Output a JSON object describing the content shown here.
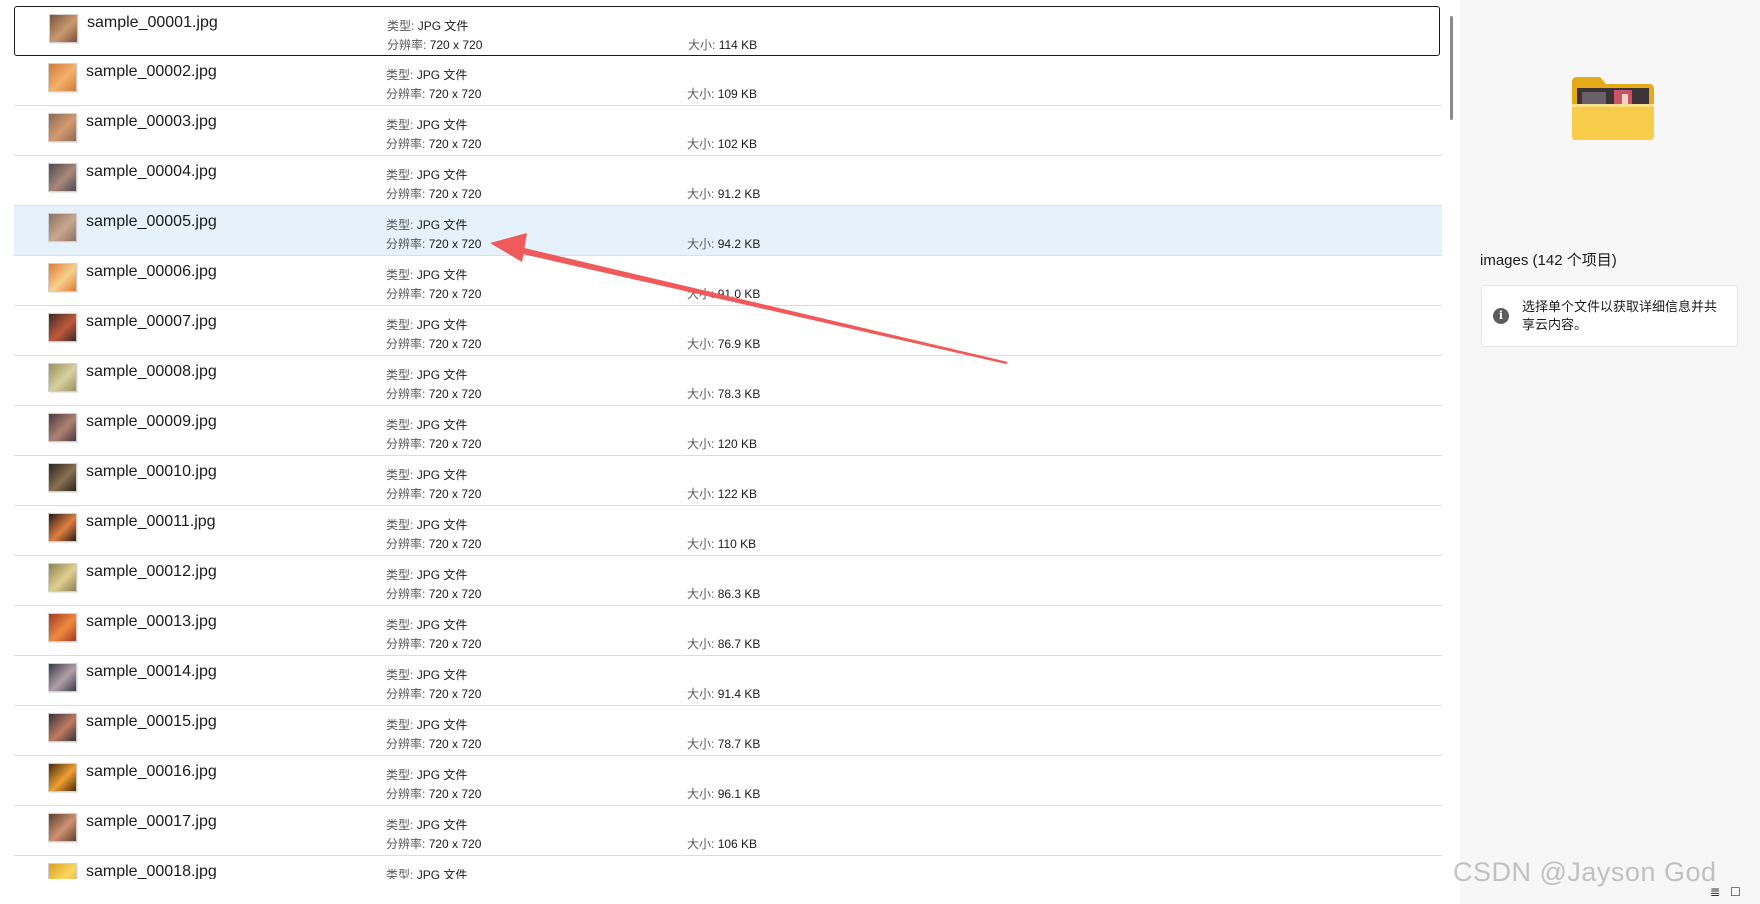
{
  "colors": {
    "selected_row_bg": "#e5f1fb",
    "arrow_color": "#f05a5a",
    "folder_yellow": "#f7c948"
  },
  "labels": {
    "type_prefix": "类型:",
    "resolution_prefix": "分辨率:",
    "size_prefix": "大小:"
  },
  "file_list": {
    "focused_index": 0,
    "selected_index": 4,
    "items": [
      {
        "name": "sample_00001.jpg",
        "type": "JPG 文件",
        "resolution": "720 x 720",
        "size": "114 KB",
        "thumb_colors": [
          "#7a5040",
          "#c99a70"
        ]
      },
      {
        "name": "sample_00002.jpg",
        "type": "JPG 文件",
        "resolution": "720 x 720",
        "size": "109 KB",
        "thumb_colors": [
          "#d07a3a",
          "#f4b26a"
        ]
      },
      {
        "name": "sample_00003.jpg",
        "type": "JPG 文件",
        "resolution": "720 x 720",
        "size": "102 KB",
        "thumb_colors": [
          "#8a6a55",
          "#d49a70"
        ]
      },
      {
        "name": "sample_00004.jpg",
        "type": "JPG 文件",
        "resolution": "720 x 720",
        "size": "91.2 KB",
        "thumb_colors": [
          "#4f4a52",
          "#a88878"
        ]
      },
      {
        "name": "sample_00005.jpg",
        "type": "JPG 文件",
        "resolution": "720 x 720",
        "size": "94.2 KB",
        "thumb_colors": [
          "#8a7060",
          "#c8a890"
        ]
      },
      {
        "name": "sample_00006.jpg",
        "type": "JPG 文件",
        "resolution": "720 x 720",
        "size": "91.0 KB",
        "thumb_colors": [
          "#e07a30",
          "#f9d090"
        ]
      },
      {
        "name": "sample_00007.jpg",
        "type": "JPG 文件",
        "resolution": "720 x 720",
        "size": "76.9 KB",
        "thumb_colors": [
          "#3e2a28",
          "#c05a3a"
        ]
      },
      {
        "name": "sample_00008.jpg",
        "type": "JPG 文件",
        "resolution": "720 x 720",
        "size": "78.3 KB",
        "thumb_colors": [
          "#9a9060",
          "#d8d0a0"
        ]
      },
      {
        "name": "sample_00009.jpg",
        "type": "JPG 文件",
        "resolution": "720 x 720",
        "size": "120 KB",
        "thumb_colors": [
          "#4a3a40",
          "#b08070"
        ]
      },
      {
        "name": "sample_00010.jpg",
        "type": "JPG 文件",
        "resolution": "720 x 720",
        "size": "122 KB",
        "thumb_colors": [
          "#2a2420",
          "#8a7050"
        ]
      },
      {
        "name": "sample_00011.jpg",
        "type": "JPG 文件",
        "resolution": "720 x 720",
        "size": "110 KB",
        "thumb_colors": [
          "#2a1a18",
          "#e08040"
        ]
      },
      {
        "name": "sample_00012.jpg",
        "type": "JPG 文件",
        "resolution": "720 x 720",
        "size": "86.3 KB",
        "thumb_colors": [
          "#8a8050",
          "#e0d090"
        ]
      },
      {
        "name": "sample_00013.jpg",
        "type": "JPG 文件",
        "resolution": "720 x 720",
        "size": "86.7 KB",
        "thumb_colors": [
          "#a03a20",
          "#f08a40"
        ]
      },
      {
        "name": "sample_00014.jpg",
        "type": "JPG 文件",
        "resolution": "720 x 720",
        "size": "91.4 KB",
        "thumb_colors": [
          "#3a3a48",
          "#b0a0a8"
        ]
      },
      {
        "name": "sample_00015.jpg",
        "type": "JPG 文件",
        "resolution": "720 x 720",
        "size": "78.7 KB",
        "thumb_colors": [
          "#3a3240",
          "#c07a60"
        ]
      },
      {
        "name": "sample_00016.jpg",
        "type": "JPG 文件",
        "resolution": "720 x 720",
        "size": "96.1 KB",
        "thumb_colors": [
          "#4a2a10",
          "#f0a030"
        ]
      },
      {
        "name": "sample_00017.jpg",
        "type": "JPG 文件",
        "resolution": "720 x 720",
        "size": "106 KB",
        "thumb_colors": [
          "#5a4030",
          "#d09070"
        ]
      },
      {
        "name": "sample_00018.jpg",
        "type": "JPG 文件",
        "resolution": "",
        "size": "",
        "thumb_colors": [
          "#e0a020",
          "#f8d860"
        ]
      }
    ]
  },
  "details": {
    "preview_icon": "folder-icon",
    "title": "images (142 个项目)",
    "info_icon_glyph": "i",
    "info_text": "选择单个文件以获取详细信息并共享云内容。"
  },
  "watermark": "CSDN @Jayson God",
  "view_switcher": {
    "details_view_glyph": "≣",
    "tiles_view_glyph": "☐"
  }
}
